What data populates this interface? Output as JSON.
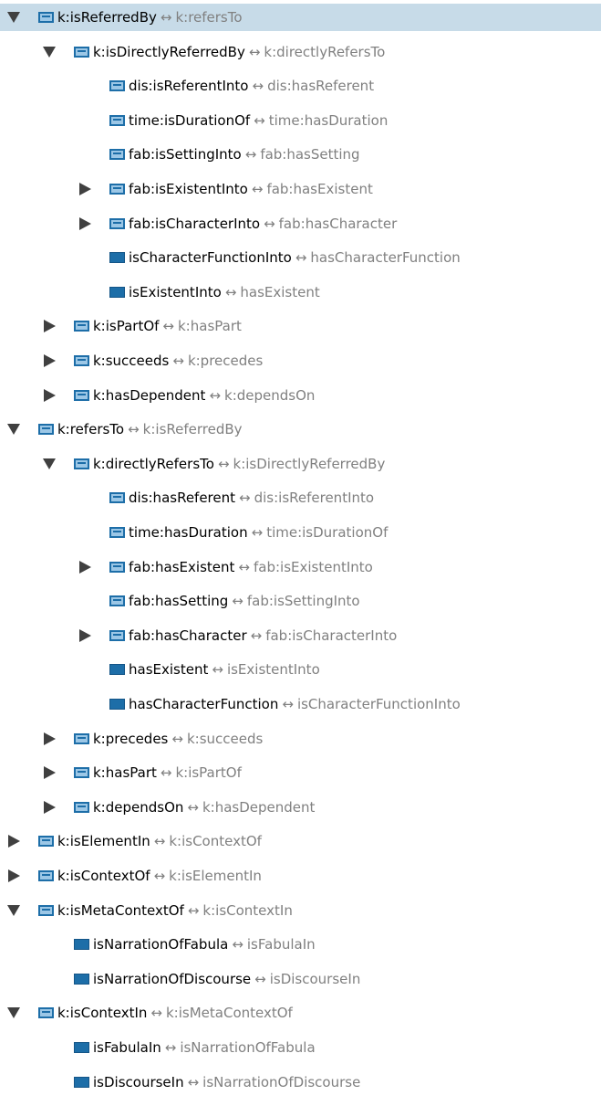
{
  "colors": {
    "selection": "#c7dbe8",
    "icon_blue": "#1d6ea8",
    "icon_light": "#9cc7e6",
    "inverse_text": "#808080"
  },
  "tree": {
    "arrow_symbol": "↔",
    "rows": [
      {
        "depth": 0,
        "toggle": "expanded",
        "icon": "object",
        "name": "k:isReferredBy",
        "inverse": "k:refersTo",
        "selected": true
      },
      {
        "depth": 1,
        "toggle": "expanded",
        "icon": "object",
        "name": "k:isDirectlyReferredBy",
        "inverse": "k:directlyRefersTo"
      },
      {
        "depth": 2,
        "toggle": "none",
        "icon": "object",
        "name": "dis:isReferentInto",
        "inverse": "dis:hasReferent"
      },
      {
        "depth": 2,
        "toggle": "none",
        "icon": "object",
        "name": "time:isDurationOf",
        "inverse": "time:hasDuration"
      },
      {
        "depth": 2,
        "toggle": "none",
        "icon": "object",
        "name": "fab:isSettingInto",
        "inverse": "fab:hasSetting"
      },
      {
        "depth": 2,
        "toggle": "collapsed",
        "icon": "object",
        "name": "fab:isExistentInto",
        "inverse": "fab:hasExistent"
      },
      {
        "depth": 2,
        "toggle": "collapsed",
        "icon": "object",
        "name": "fab:isCharacterInto",
        "inverse": "fab:hasCharacter"
      },
      {
        "depth": 2,
        "toggle": "none",
        "icon": "solid",
        "name": "isCharacterFunctionInto",
        "inverse": "hasCharacterFunction"
      },
      {
        "depth": 2,
        "toggle": "none",
        "icon": "solid",
        "name": "isExistentInto",
        "inverse": "hasExistent"
      },
      {
        "depth": 1,
        "toggle": "collapsed",
        "icon": "object",
        "name": "k:isPartOf",
        "inverse": "k:hasPart"
      },
      {
        "depth": 1,
        "toggle": "collapsed",
        "icon": "object",
        "name": "k:succeeds",
        "inverse": "k:precedes"
      },
      {
        "depth": 1,
        "toggle": "collapsed",
        "icon": "object",
        "name": "k:hasDependent",
        "inverse": "k:dependsOn"
      },
      {
        "depth": 0,
        "toggle": "expanded",
        "icon": "object",
        "name": "k:refersTo",
        "inverse": "k:isReferredBy"
      },
      {
        "depth": 1,
        "toggle": "expanded",
        "icon": "object",
        "name": "k:directlyRefersTo",
        "inverse": "k:isDirectlyReferredBy"
      },
      {
        "depth": 2,
        "toggle": "none",
        "icon": "object",
        "name": "dis:hasReferent",
        "inverse": "dis:isReferentInto"
      },
      {
        "depth": 2,
        "toggle": "none",
        "icon": "object",
        "name": "time:hasDuration",
        "inverse": "time:isDurationOf"
      },
      {
        "depth": 2,
        "toggle": "collapsed",
        "icon": "object",
        "name": "fab:hasExistent",
        "inverse": "fab:isExistentInto"
      },
      {
        "depth": 2,
        "toggle": "none",
        "icon": "object",
        "name": "fab:hasSetting",
        "inverse": "fab:isSettingInto"
      },
      {
        "depth": 2,
        "toggle": "collapsed",
        "icon": "object",
        "name": "fab:hasCharacter",
        "inverse": "fab:isCharacterInto"
      },
      {
        "depth": 2,
        "toggle": "none",
        "icon": "solid",
        "name": "hasExistent",
        "inverse": "isExistentInto"
      },
      {
        "depth": 2,
        "toggle": "none",
        "icon": "solid",
        "name": "hasCharacterFunction",
        "inverse": "isCharacterFunctionInto"
      },
      {
        "depth": 1,
        "toggle": "collapsed",
        "icon": "object",
        "name": "k:precedes",
        "inverse": "k:succeeds"
      },
      {
        "depth": 1,
        "toggle": "collapsed",
        "icon": "object",
        "name": "k:hasPart",
        "inverse": "k:isPartOf"
      },
      {
        "depth": 1,
        "toggle": "collapsed",
        "icon": "object",
        "name": "k:dependsOn",
        "inverse": "k:hasDependent"
      },
      {
        "depth": 0,
        "toggle": "collapsed",
        "icon": "object",
        "name": "k:isElementIn",
        "inverse": "k:isContextOf"
      },
      {
        "depth": 0,
        "toggle": "collapsed",
        "icon": "object",
        "name": "k:isContextOf",
        "inverse": "k:isElementIn"
      },
      {
        "depth": 0,
        "toggle": "expanded",
        "icon": "object",
        "name": "k:isMetaContextOf",
        "inverse": "k:isContextIn"
      },
      {
        "depth": 1,
        "toggle": "none",
        "icon": "solid",
        "name": "isNarrationOfFabula",
        "inverse": "isFabulaIn"
      },
      {
        "depth": 1,
        "toggle": "none",
        "icon": "solid",
        "name": "isNarrationOfDiscourse",
        "inverse": "isDiscourseIn"
      },
      {
        "depth": 0,
        "toggle": "expanded",
        "icon": "object",
        "name": "k:isContextIn",
        "inverse": "k:isMetaContextOf"
      },
      {
        "depth": 1,
        "toggle": "none",
        "icon": "solid",
        "name": "isFabulaIn",
        "inverse": "isNarrationOfFabula"
      },
      {
        "depth": 1,
        "toggle": "none",
        "icon": "solid",
        "name": "isDiscourseIn",
        "inverse": "isNarrationOfDiscourse"
      }
    ]
  }
}
